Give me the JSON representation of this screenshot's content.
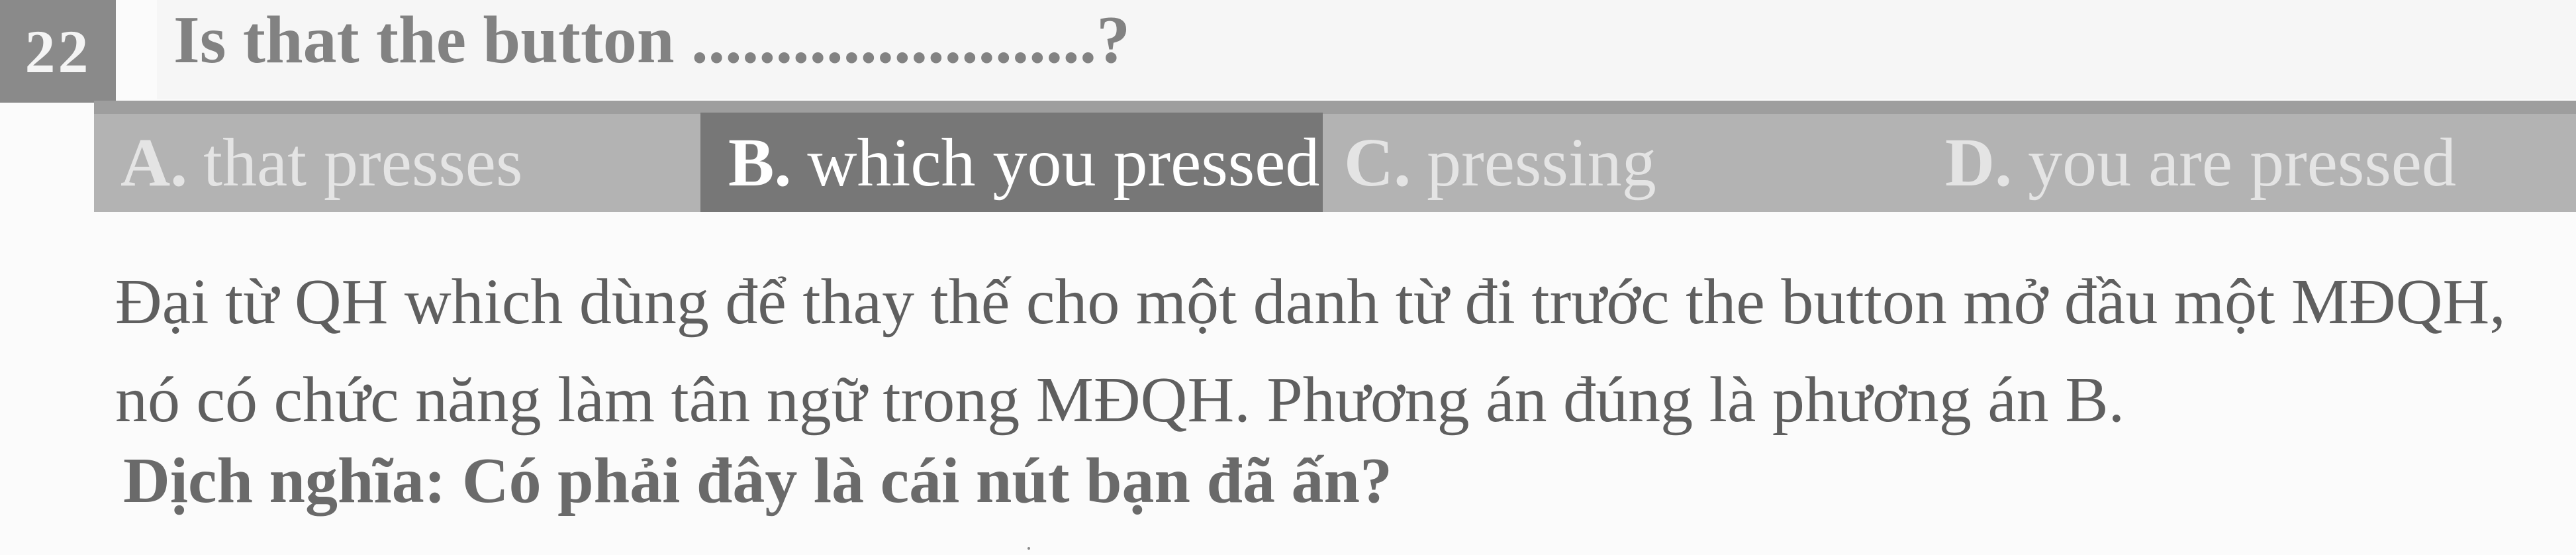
{
  "question": {
    "number": "22",
    "text": "Is that the button ........................?"
  },
  "options": [
    {
      "letter": "A.",
      "text": "that presses",
      "selected": false
    },
    {
      "letter": "B.",
      "text": "which you pressed",
      "selected": true
    },
    {
      "letter": "C.",
      "text": "pressing",
      "selected": false
    },
    {
      "letter": "D.",
      "text": "you are pressed",
      "selected": false
    }
  ],
  "explanation": {
    "line1": "Đại từ QH which dùng để thay thế cho một danh từ đi trước the button mở đầu một MĐQH,",
    "line2": "nó có chức năng làm tân ngữ trong MĐQH. Phương án đúng là phương án B.",
    "translation": "Dịch nghĩa: Có phải đây là cái nút bạn đã ấn?"
  },
  "colors": {
    "selected_option_bg": "#777777",
    "options_bar_bg": "#b3b3b3",
    "number_box_bg": "#8a8a8a"
  }
}
